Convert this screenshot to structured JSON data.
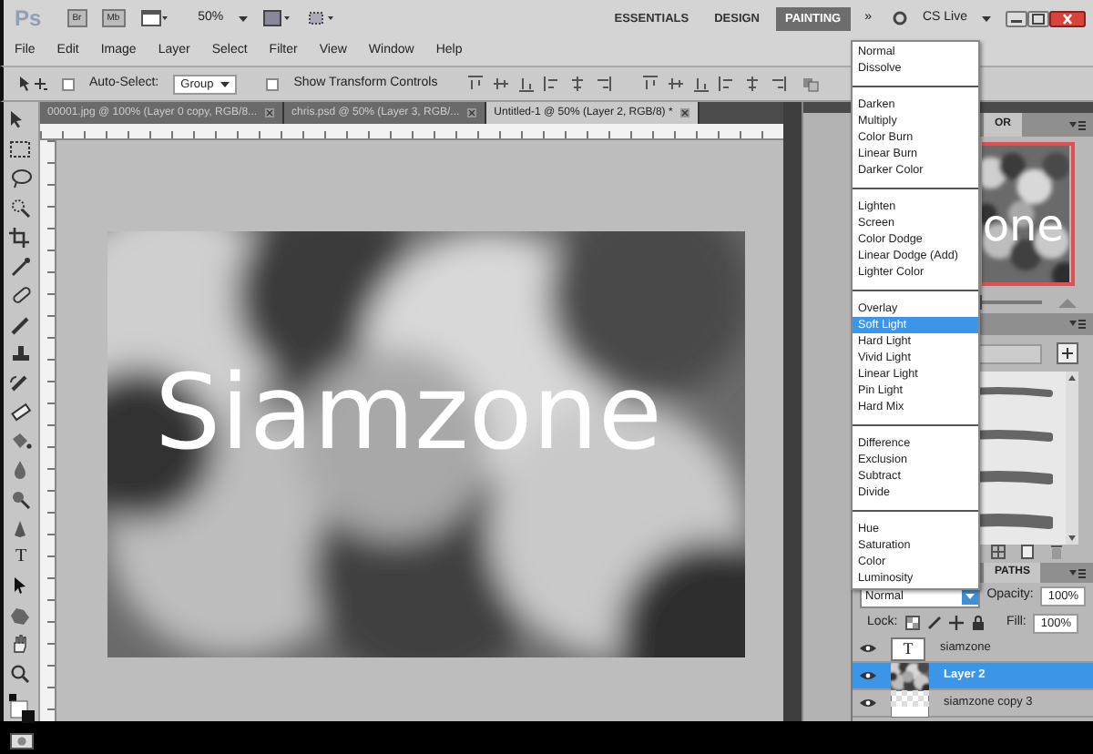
{
  "app_bar": {
    "logo": "Ps",
    "bridge": "Br",
    "mini_bridge": "Mb",
    "zoom": "50%",
    "workspaces": [
      {
        "label": "ESSENTIALS",
        "selected": false
      },
      {
        "label": "DESIGN",
        "selected": false
      },
      {
        "label": "PAINTING",
        "selected": true
      }
    ],
    "more": "»",
    "cs_live": "CS Live"
  },
  "menu": [
    "File",
    "Edit",
    "Image",
    "Layer",
    "Select",
    "Filter",
    "View",
    "Window",
    "Help"
  ],
  "options_bar": {
    "auto_select": {
      "label": "Auto-Select:",
      "checked": false
    },
    "auto_select_target": "Group",
    "transform_controls": {
      "label": "Show Transform Controls",
      "checked": false
    }
  },
  "document_tabs": [
    {
      "label": "00001.jpg @ 100% (Layer 0 copy, RGB/8...",
      "selected": false
    },
    {
      "label": "chris.psd @ 50% (Layer 3, RGB/...",
      "selected": false
    },
    {
      "label": "Untitled-1 @ 50% (Layer 2, RGB/8) *",
      "selected": true
    }
  ],
  "toolbar": {
    "type_tool": "T"
  },
  "canvas": {
    "text": "Siamzone"
  },
  "navigator": {
    "tab": "OR",
    "preview_text": "one",
    "zoom_slider": {
      "level": 0.08
    }
  },
  "blend_menu": {
    "groups": [
      [
        {
          "label": "Normal",
          "selected": false
        },
        {
          "label": "Dissolve",
          "selected": false
        }
      ],
      [
        {
          "label": "Darken",
          "selected": false
        },
        {
          "label": "Multiply",
          "selected": false
        },
        {
          "label": "Color Burn",
          "selected": false
        },
        {
          "label": "Linear Burn",
          "selected": false
        },
        {
          "label": "Darker Color",
          "selected": false
        }
      ],
      [
        {
          "label": "Lighten",
          "selected": false
        },
        {
          "label": "Screen",
          "selected": false
        },
        {
          "label": "Color Dodge",
          "selected": false
        },
        {
          "label": "Linear Dodge (Add)",
          "selected": false
        },
        {
          "label": "Lighter Color",
          "selected": false
        }
      ],
      [
        {
          "label": "Overlay",
          "selected": false
        },
        {
          "label": "Soft Light",
          "selected": true
        },
        {
          "label": "Hard Light",
          "selected": false
        },
        {
          "label": "Vivid Light",
          "selected": false
        },
        {
          "label": "Linear Light",
          "selected": false
        },
        {
          "label": "Pin Light",
          "selected": false
        },
        {
          "label": "Hard Mix",
          "selected": false
        }
      ],
      [
        {
          "label": "Difference",
          "selected": false
        },
        {
          "label": "Exclusion",
          "selected": false
        },
        {
          "label": "Subtract",
          "selected": false
        },
        {
          "label": "Divide",
          "selected": false
        }
      ],
      [
        {
          "label": "Hue",
          "selected": false
        },
        {
          "label": "Saturation",
          "selected": false
        },
        {
          "label": "Color",
          "selected": false
        },
        {
          "label": "Luminosity",
          "selected": false
        }
      ]
    ]
  },
  "layers_panel": {
    "tab": "PATHS",
    "blend_mode": "Normal",
    "opacity_label": "Opacity:",
    "opacity": "100%",
    "lock_label": "Lock:",
    "fill_label": "Fill:",
    "fill": "100%",
    "layers": [
      {
        "name": "siamzone",
        "kind": "text",
        "thumb_glyph": "T",
        "selected": false
      },
      {
        "name": "Layer 2",
        "selected": true
      },
      {
        "name": "siamzone copy 3",
        "kind": "transparent",
        "selected": false
      }
    ]
  }
}
